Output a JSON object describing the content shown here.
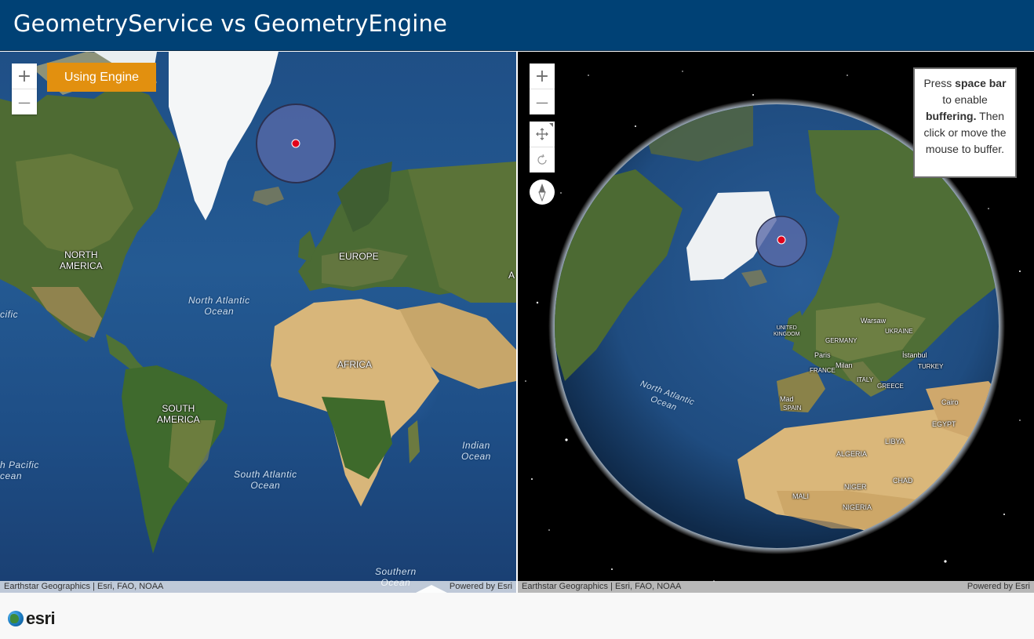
{
  "header": {
    "title": "GeometryService vs GeometryEngine"
  },
  "view_2d": {
    "toggle_label": "Using Engine",
    "zoom_in": "+",
    "zoom_out": "—",
    "attribution_left": "Earthstar Geographics | Esri, FAO, NOAA",
    "attribution_right": "Powered by Esri",
    "labels": {
      "north_america": "NORTH\nAMERICA",
      "europe": "EUROPE",
      "africa": "AFRICA",
      "south_america": "SOUTH\nAMERICA",
      "asia_edge": "A",
      "north_atlantic": "North Atlantic\nOcean",
      "south_atlantic": "South Atlantic\nOcean",
      "indian": "Indian\nOcean",
      "pacific_north": "cific",
      "pacific_south": "h Pacific\ncean",
      "southern": "Southern\nOcean"
    }
  },
  "view_3d": {
    "zoom_in": "+",
    "zoom_out": "—",
    "instructions": {
      "line1_pre": "Press ",
      "line1_bold": "space bar",
      "line2": " to enable ",
      "line3_bold": "buffering.",
      "line3_post": " Then click or move the mouse to buffer."
    },
    "attribution_left": "Earthstar Geographics | Esri, FAO, NOAA",
    "attribution_right": "Powered by Esri",
    "labels": {
      "north_atlantic": "North Atlantic\nOcean",
      "spain": "SPAIN",
      "algeria": "ALGERIA",
      "libya": "LIBYA",
      "egypt": "EGYPT",
      "mali": "MALI",
      "niger": "NIGER",
      "chad": "CHAD",
      "nigeria": "NIGERIA",
      "greece": "GREECE",
      "italy": "ITALY",
      "france": "FRANCE",
      "paris": "Paris",
      "milan": "Milan",
      "warsaw": "Warsaw",
      "istanbul": "İstanbul",
      "united_kingdom": "UNITED\nKINGDOM",
      "cairo": "Cairo",
      "germany": "GERMANY",
      "ukraine": "UKRAINE",
      "turkey": "TURKEY",
      "mad": "Mad"
    }
  },
  "footer": {
    "logo_text": "esri"
  },
  "icons": [
    "pan-icon",
    "rotate-icon",
    "compass-icon",
    "zoom-in-icon",
    "zoom-out-icon"
  ],
  "colors": {
    "header_bg": "#004175",
    "toggle_bg": "#e2900f",
    "buffer_fill": "#5a6aa8",
    "point": "#e0001b"
  }
}
